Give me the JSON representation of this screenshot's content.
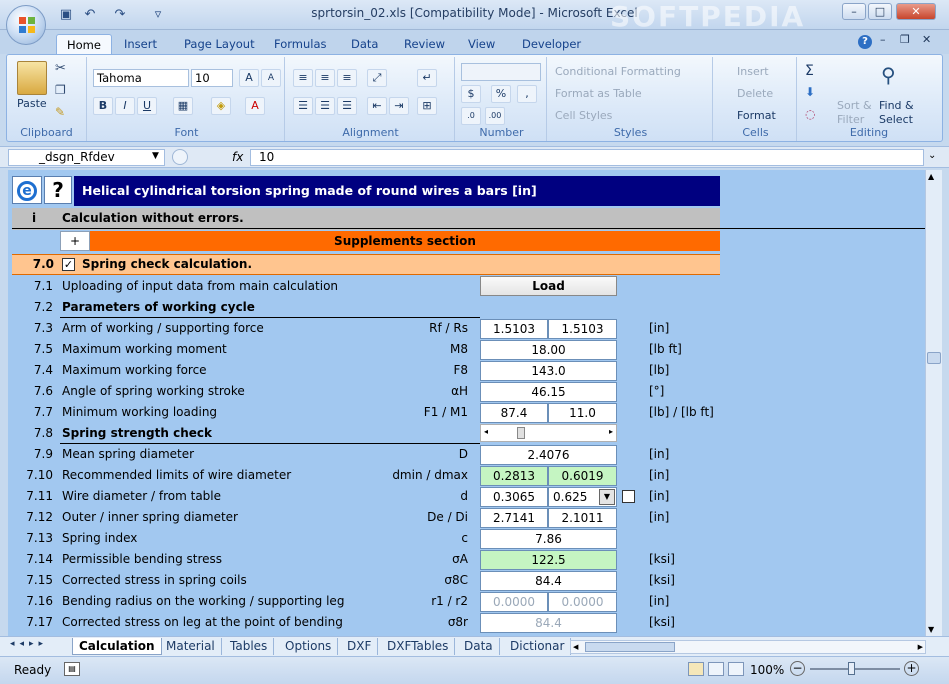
{
  "window": {
    "title": "sprtorsin_02.xls  [Compatibility Mode] - Microsoft Excel",
    "watermark": "SOFTPEDIA",
    "minimize": "–",
    "maximize": "□",
    "close": "✕"
  },
  "quick_access": {
    "save": "▣",
    "undo": "↶",
    "redo": "↷",
    "customize": "▿"
  },
  "ribbon_tabs": [
    "Home",
    "Insert",
    "Page Layout",
    "Formulas",
    "Data",
    "Review",
    "View",
    "Developer"
  ],
  "ribbon": {
    "clipboard": {
      "label": "Clipboard",
      "paste": "Paste"
    },
    "font": {
      "label": "Font",
      "family": "Tahoma",
      "size": "10",
      "bold": "B",
      "italic": "I",
      "underline": "U"
    },
    "alignment": {
      "label": "Alignment"
    },
    "number": {
      "label": "Number",
      "currency": "$",
      "percent": "%",
      "comma": ","
    },
    "styles": {
      "label": "Styles",
      "conditional": "Conditional Formatting",
      "as_table": "Format as Table",
      "cell_styles": "Cell Styles"
    },
    "cells": {
      "label": "Cells",
      "insert": "Insert",
      "delete": "Delete",
      "format": "Format"
    },
    "editing": {
      "label": "Editing",
      "sum": "Σ",
      "sort": "Sort &",
      "filter": "Filter",
      "find": "Find &",
      "select": "Select"
    }
  },
  "formula_bar": {
    "name_box": "_dsgn_Rfdev",
    "fx": "fx",
    "value": "10"
  },
  "sheet": {
    "header_title": "Helical cylindrical torsion spring made of round wires a bars [in]",
    "status_index": "i",
    "status_text": "Calculation without errors.",
    "plus": "+",
    "supplements": "Supplements section",
    "section_num": "7.0",
    "section_title": "Spring check calculation.",
    "load_button": "Load",
    "rows": [
      {
        "num": "7.1",
        "desc": "Uploading of input data from main calculation"
      },
      {
        "num": "7.2",
        "desc": "Parameters of working cycle"
      },
      {
        "num": "7.3",
        "desc": "Arm of working / supporting force",
        "sym": "Rf / Rs",
        "v1": "1.5103",
        "v2": "1.5103",
        "unit": "[in]"
      },
      {
        "num": "7.5",
        "desc": "Maximum working moment",
        "sym": "M8",
        "v": "18.00",
        "unit": "[lb ft]"
      },
      {
        "num": "7.4",
        "desc": "Maximum working force",
        "sym": "F8",
        "v": "143.0",
        "unit": "[lb]"
      },
      {
        "num": "7.6",
        "desc": "Angle of spring working stroke",
        "sym": "αH",
        "v": "46.15",
        "unit": "[°]"
      },
      {
        "num": "7.7",
        "desc": "Minimum working loading",
        "sym": "F1 / M1",
        "v1": "87.4",
        "v2": "11.0",
        "unit": "[lb] / [lb ft]"
      },
      {
        "num": "7.8",
        "desc": "Spring strength check"
      },
      {
        "num": "7.9",
        "desc": "Mean spring diameter",
        "sym": "D",
        "v": "2.4076",
        "unit": "[in]"
      },
      {
        "num": "7.10",
        "desc": "Recommended limits of wire diameter",
        "sym": "dmin / dmax",
        "v1": "0.2813",
        "v2": "0.6019",
        "unit": "[in]"
      },
      {
        "num": "7.11",
        "desc": "Wire diameter / from table",
        "sym": "d",
        "v1": "0.3065",
        "v2": "0.625",
        "unit": "[in]"
      },
      {
        "num": "7.12",
        "desc": "Outer / inner spring diameter",
        "sym": "De / Di",
        "v1": "2.7141",
        "v2": "2.1011",
        "unit": "[in]"
      },
      {
        "num": "7.13",
        "desc": "Spring index",
        "sym": "c",
        "v": "7.86",
        "unit": ""
      },
      {
        "num": "7.14",
        "desc": "Permissible bending stress",
        "sym": "σA",
        "v": "122.5",
        "unit": "[ksi]"
      },
      {
        "num": "7.15",
        "desc": "Corrected stress in spring coils",
        "sym": "σ8C",
        "v": "84.4",
        "unit": "[ksi]"
      },
      {
        "num": "7.16",
        "desc": "Bending radius on the working / supporting leg",
        "sym": "r1 / r2",
        "v1": "0.0000",
        "v2": "0.0000",
        "unit": "[in]"
      },
      {
        "num": "7.17",
        "desc": "Corrected stress on leg at the point of bending",
        "sym": "σ8r",
        "v": "84.4",
        "unit": "[ksi]"
      }
    ]
  },
  "sheet_tabs": [
    "Calculation",
    "Material",
    "Tables",
    "Options",
    "DXF",
    "DXFTables",
    "Data",
    "Dictionar"
  ],
  "status_bar": {
    "ready": "Ready",
    "zoom": "100%"
  },
  "colors": {
    "section_orange": "#ff6a00",
    "header_navy": "#000080",
    "sheet_blue": "#a2c8f0",
    "green_cell": "#c5f5c2"
  }
}
